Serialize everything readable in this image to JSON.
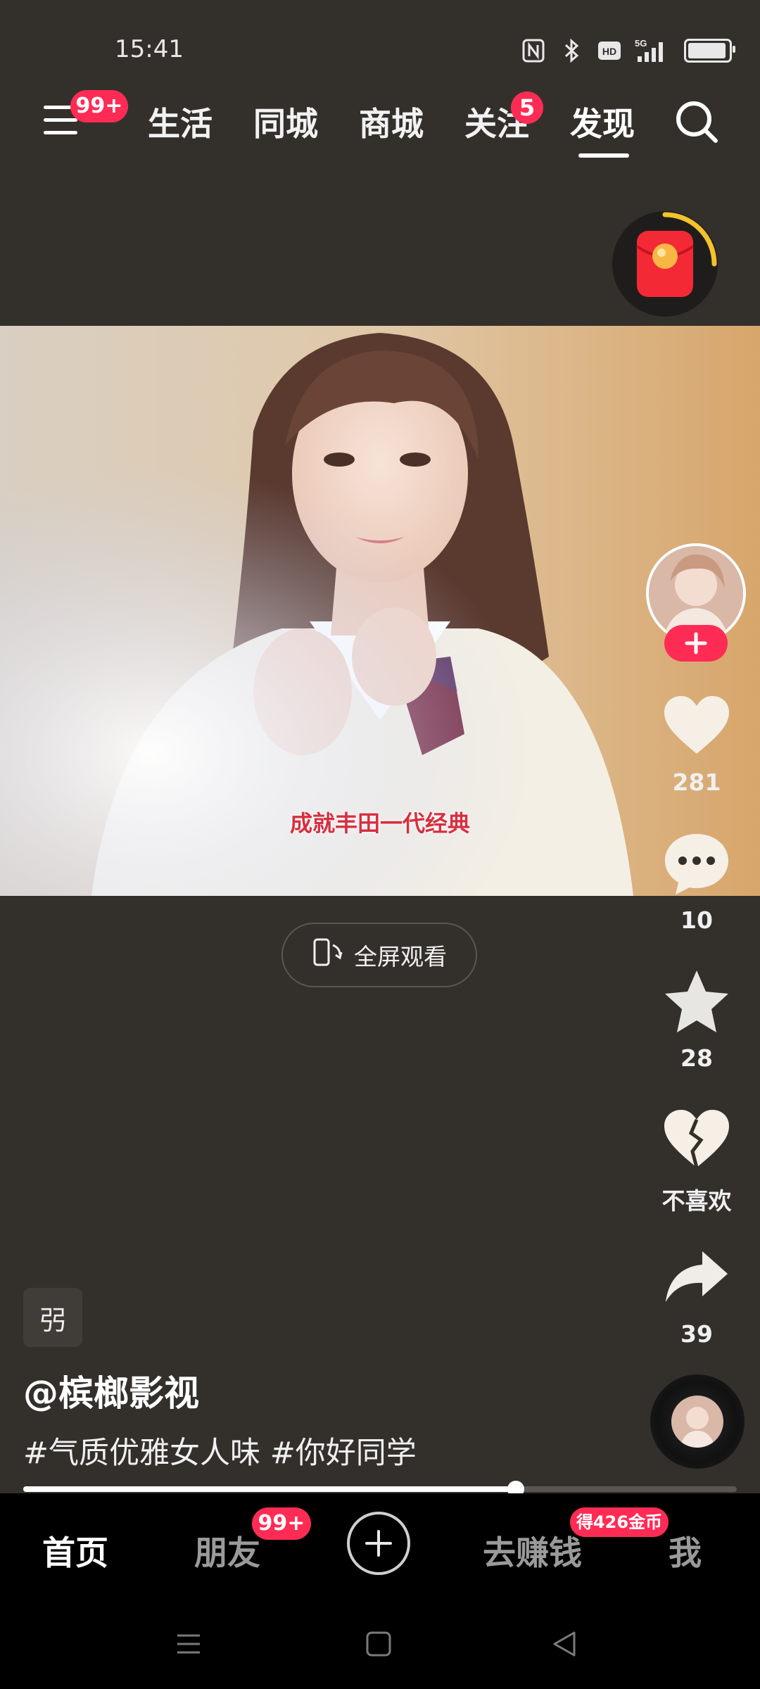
{
  "status": {
    "time": "15:41",
    "icons": [
      "nfc-icon",
      "bluetooth-icon",
      "hd-icon",
      "5g-signal-icon",
      "battery-icon"
    ],
    "battery_level": 0.95
  },
  "top_nav": {
    "menu_badge": "99+",
    "tabs": [
      {
        "label": "生活"
      },
      {
        "label": "同城"
      },
      {
        "label": "商城"
      },
      {
        "label": "关注",
        "badge": "5"
      },
      {
        "label": "发现",
        "active": true
      }
    ]
  },
  "video": {
    "subtitle": "成就丰田一代经典"
  },
  "fullscreen": {
    "label": "全屏观看"
  },
  "actions": {
    "likes": "281",
    "comments": "10",
    "favorites": "28",
    "dislike_label": "不喜欢",
    "shares": "39"
  },
  "post": {
    "tag_chip": "弜",
    "author": "@槟榔影视",
    "caption": "#气质优雅女人味 #你好同学"
  },
  "playback": {
    "progress": 0.69
  },
  "bottom_nav": {
    "home": "首页",
    "friends": "朋友",
    "friends_badge": "99+",
    "earn": "去赚钱",
    "earn_badge": "得426金币",
    "me": "我"
  },
  "colors": {
    "accent": "#fe2c55",
    "background": "#33302c"
  }
}
